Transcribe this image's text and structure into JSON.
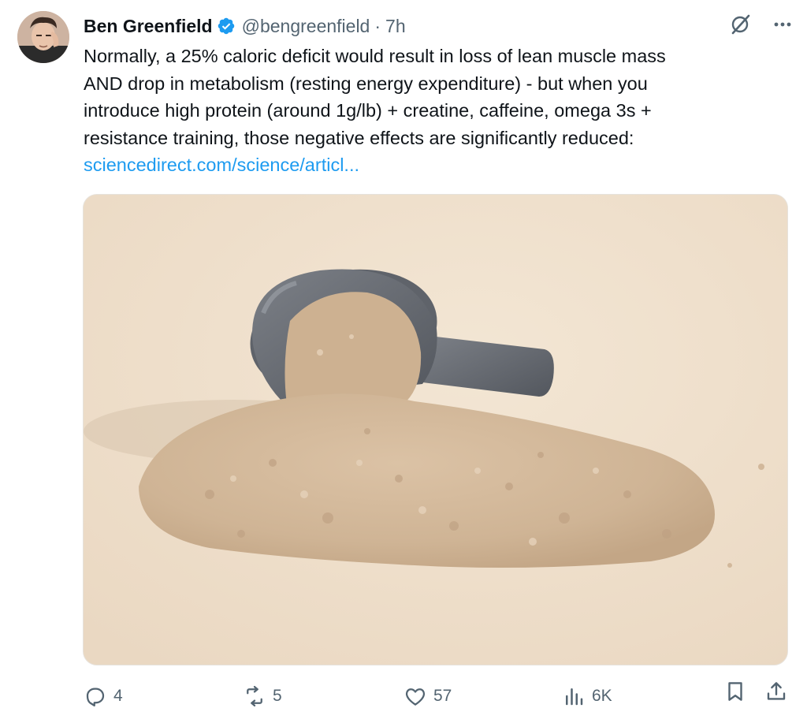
{
  "tweet": {
    "author": {
      "display_name": "Ben Greenfield",
      "handle": "@bengreenfield",
      "separator": "·",
      "time": "7h"
    },
    "text_lines": [
      "Normally, a 25% caloric deficit would result in loss of lean muscle mass",
      "AND drop in metabolism (resting energy expenditure) - but when you",
      "introduce high protein (around 1g/lb) + creatine, caffeine, omega 3s +",
      "resistance training, those negative effects are significantly reduced:"
    ],
    "link_text": "sciencedirect.com/science/articl...",
    "media": {
      "icon": "protein-powder-scoop-photo"
    },
    "actions": {
      "replies": "4",
      "reposts": "5",
      "likes": "57",
      "views": "6K"
    },
    "colors": {
      "accent": "#1d9bf0",
      "muted": "#536471",
      "text": "#0f1419"
    }
  }
}
